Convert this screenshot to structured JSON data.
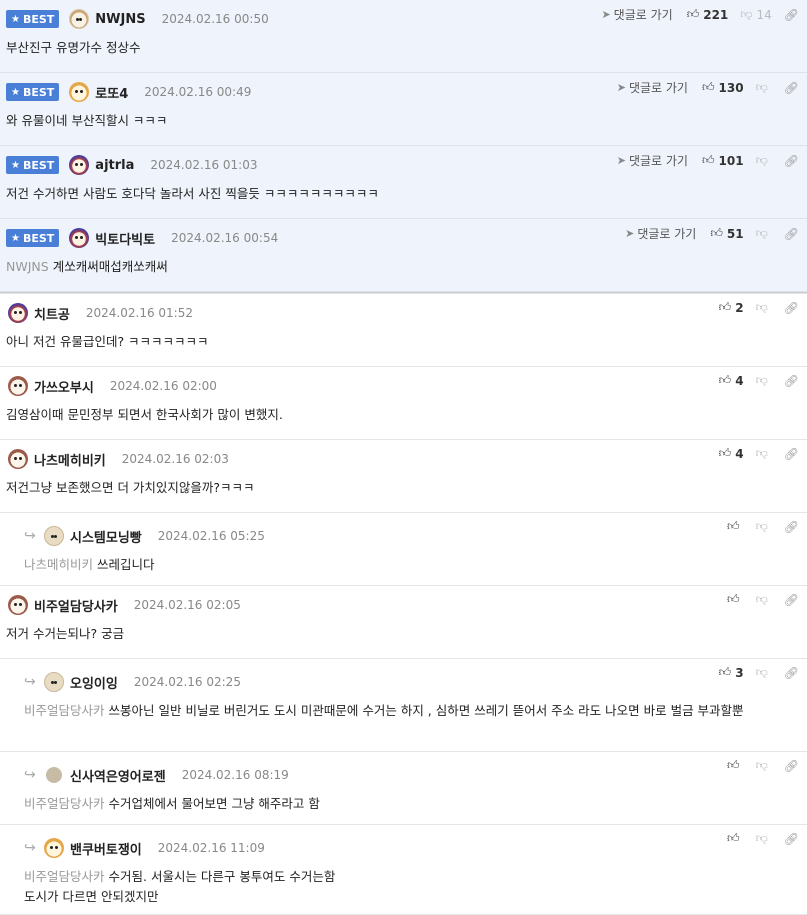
{
  "best_comments": [
    {
      "badge": "BEST",
      "avatar": "dog1",
      "nick": "NWJNS",
      "date": "2024.02.16 00:50",
      "mention": "",
      "text": "부산진구 유명가수 정상수",
      "reply_label": "댓글로 가기",
      "up": "221",
      "down": "14"
    },
    {
      "badge": "BEST",
      "avatar": "dog2",
      "nick": "로또4",
      "date": "2024.02.16 00:49",
      "mention": "",
      "text": "와 유물이네 부산직할시 ㅋㅋㅋ",
      "reply_label": "댓글로 가기",
      "up": "130",
      "down": ""
    },
    {
      "badge": "BEST",
      "avatar": "dog3",
      "nick": "ajtrla",
      "date": "2024.02.16 01:03",
      "mention": "",
      "text": "저건 수거하면 사람도 호다닥 놀라서 사진 찍을듯 ㅋㅋㅋㅋㅋㅋㅋㅋㅋㅋ",
      "reply_label": "댓글로 가기",
      "up": "101",
      "down": ""
    },
    {
      "badge": "BEST",
      "avatar": "dog3",
      "nick": "빅토다빅토",
      "date": "2024.02.16 00:54",
      "mention": "NWJNS",
      "text": "계쏘캐써매섭캐쏘캐써",
      "reply_label": "댓글로 가기",
      "up": "51",
      "down": ""
    }
  ],
  "comments": [
    {
      "reply": false,
      "avatar": "dog3",
      "nick": "치트공",
      "date": "2024.02.16 01:52",
      "mention": "",
      "text": "아니 저건 유물급인데? ㅋㅋㅋㅋㅋㅋㅋ",
      "up": "2",
      "down": ""
    },
    {
      "reply": false,
      "avatar": "dog4",
      "nick": "가쓰오부시",
      "date": "2024.02.16 02:00",
      "mention": "",
      "text": "김영삼이때 문민정부 되면서 한국사회가 많이 변했지.",
      "up": "4",
      "down": ""
    },
    {
      "reply": false,
      "avatar": "dog4",
      "nick": "나츠메히비키",
      "date": "2024.02.16 02:03",
      "mention": "",
      "text": "저건그냥 보존했으면 더 가치있지않을까?ㅋㅋㅋ",
      "up": "4",
      "down": ""
    },
    {
      "reply": true,
      "avatar": "dog5",
      "nick": "시스템모닝빵",
      "date": "2024.02.16 05:25",
      "mention": "나츠메히비키",
      "text": "쓰레깁니다",
      "up": "",
      "down": ""
    },
    {
      "reply": false,
      "avatar": "dog4",
      "nick": "비주얼담당사카",
      "date": "2024.02.16 02:05",
      "mention": "",
      "text": "저거 수거는되나? 궁금",
      "up": "",
      "down": ""
    },
    {
      "reply": true,
      "avatar": "dog5",
      "nick": "오잉이잉",
      "date": "2024.02.16 02:25",
      "mention": "비주얼담당사카",
      "text": "쓰봉아닌 일반 비닐로 버린거도 도시 미관때문에 수거는 하지 , 심하면 쓰레기 뜯어서 주소 라도 나오면 바로 벌금 부과할뿐",
      "up": "3",
      "down": ""
    },
    {
      "reply": true,
      "avatar": "gray",
      "nick": "신사역은영어로젠",
      "date": "2024.02.16 08:19",
      "mention": "비주얼담당사카",
      "text": "수거업체에서 물어보면 그냥 해주라고 함",
      "up": "",
      "down": ""
    },
    {
      "reply": true,
      "avatar": "dog2",
      "nick": "밴쿠버토쟁이",
      "date": "2024.02.16 11:09",
      "mention": "비주얼담당사카",
      "text": "수거됨. 서울시는 다른구 봉투여도 수거는함\n도시가 다르면 안되겠지만",
      "up": "",
      "down": ""
    }
  ],
  "icons": {
    "star": "star-icon",
    "thumb_up": "thumbs-up-icon",
    "thumb_down": "thumbs-down-icon",
    "share": "link-icon",
    "reply": "reply-arrow-icon",
    "send": "send-icon"
  },
  "colors": {
    "best_bg": "#eff3fb",
    "badge": "#4a7fd8",
    "mention": "#999999"
  }
}
